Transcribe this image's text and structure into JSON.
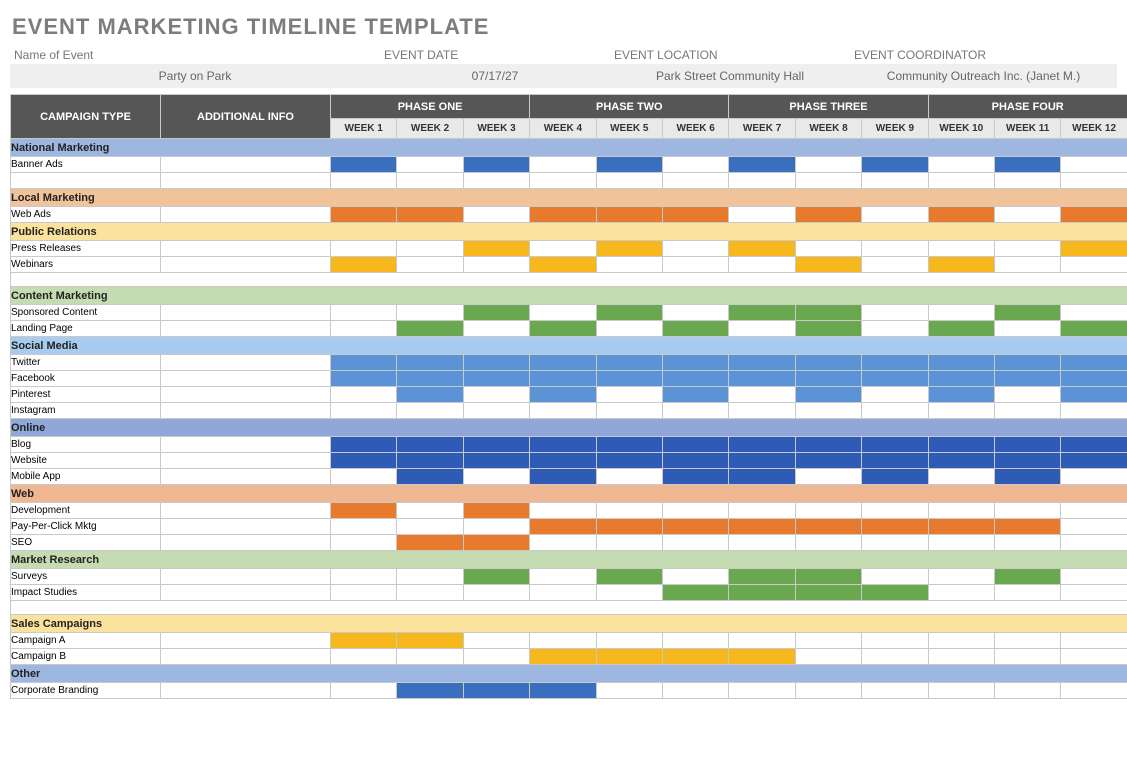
{
  "title": "EVENT MARKETING TIMELINE TEMPLATE",
  "meta": {
    "name_label": "Name of Event",
    "name_value": "Party on Park",
    "date_label": "EVENT DATE",
    "date_value": "07/17/27",
    "loc_label": "EVENT LOCATION",
    "loc_value": "Park Street Community Hall",
    "coord_label": "EVENT COORDINATOR",
    "coord_value": "Community Outreach Inc. (Janet M.)"
  },
  "headers": {
    "campaign": "CAMPAIGN TYPE",
    "info": "ADDITIONAL INFO",
    "phases": [
      "PHASE ONE",
      "PHASE TWO",
      "PHASE THREE",
      "PHASE FOUR"
    ],
    "weeks": [
      "WEEK 1",
      "WEEK 2",
      "WEEK 3",
      "WEEK 4",
      "WEEK 5",
      "WEEK 6",
      "WEEK 7",
      "WEEK 8",
      "WEEK 9",
      "WEEK 10",
      "WEEK 11",
      "WEEK 12"
    ]
  },
  "sections": [
    {
      "label": "National Marketing",
      "class": "sh-national",
      "rows": [
        {
          "label": "Banner Ads",
          "color": "c-blue",
          "weeks": [
            1,
            3,
            5,
            7,
            9,
            11
          ]
        },
        {
          "label": "",
          "color": "",
          "weeks": []
        }
      ]
    },
    {
      "label": "Local Marketing",
      "class": "sh-local",
      "rows": [
        {
          "label": "Web Ads",
          "color": "c-orange",
          "weeks": [
            1,
            2,
            4,
            5,
            6,
            8,
            10,
            12
          ]
        }
      ]
    },
    {
      "label": "Public Relations",
      "class": "sh-public",
      "rows": [
        {
          "label": "Press Releases",
          "color": "c-yellow",
          "weeks": [
            3,
            5,
            7,
            12
          ]
        },
        {
          "label": "Webinars",
          "color": "c-yellow",
          "weeks": [
            1,
            4,
            8,
            10
          ]
        }
      ],
      "spacer_after": true
    },
    {
      "label": "Content Marketing",
      "class": "sh-content",
      "rows": [
        {
          "label": "Sponsored Content",
          "color": "c-green",
          "weeks": [
            3,
            5,
            7,
            8,
            11
          ]
        },
        {
          "label": "Landing Page",
          "color": "c-green",
          "weeks": [
            2,
            4,
            6,
            8,
            10,
            12
          ]
        }
      ]
    },
    {
      "label": "Social Media",
      "class": "sh-social",
      "rows": [
        {
          "label": "Twitter",
          "color": "c-blue2",
          "weeks": [
            1,
            2,
            3,
            4,
            5,
            6,
            7,
            8,
            9,
            10,
            11,
            12
          ]
        },
        {
          "label": "Facebook",
          "color": "c-blue2",
          "weeks": [
            1,
            2,
            3,
            4,
            5,
            6,
            7,
            8,
            9,
            10,
            11,
            12
          ]
        },
        {
          "label": "Pinterest",
          "color": "c-blue2",
          "weeks": [
            2,
            4,
            6,
            8,
            10,
            12
          ]
        },
        {
          "label": "Instagram",
          "color": "c-blue2",
          "weeks": []
        }
      ]
    },
    {
      "label": "Online",
      "class": "sh-online",
      "rows": [
        {
          "label": "Blog",
          "color": "c-blue3",
          "weeks": [
            1,
            2,
            3,
            4,
            5,
            6,
            7,
            8,
            9,
            10,
            11,
            12
          ]
        },
        {
          "label": "Website",
          "color": "c-blue3",
          "weeks": [
            1,
            2,
            3,
            4,
            5,
            6,
            7,
            8,
            9,
            10,
            11,
            12
          ]
        },
        {
          "label": "Mobile App",
          "color": "c-blue3",
          "weeks": [
            2,
            4,
            6,
            7,
            9,
            11
          ]
        }
      ]
    },
    {
      "label": "Web",
      "class": "sh-web",
      "rows": [
        {
          "label": "Development",
          "color": "c-orange",
          "weeks": [
            1,
            3
          ]
        },
        {
          "label": "Pay-Per-Click Mktg",
          "color": "c-orange",
          "weeks": [
            4,
            5,
            6,
            7,
            8,
            9,
            10,
            11
          ]
        },
        {
          "label": "SEO",
          "color": "c-orange",
          "weeks": [
            2,
            3
          ]
        }
      ]
    },
    {
      "label": "Market Research",
      "class": "sh-market",
      "rows": [
        {
          "label": "Surveys",
          "color": "c-green",
          "weeks": [
            3,
            5,
            7,
            8,
            11
          ]
        },
        {
          "label": "Impact Studies",
          "color": "c-green",
          "weeks": [
            6,
            7,
            8,
            9
          ]
        }
      ],
      "spacer_after": true
    },
    {
      "label": "Sales Campaigns",
      "class": "sh-sales",
      "rows": [
        {
          "label": "Campaign A",
          "color": "c-yellow",
          "weeks": [
            1,
            2
          ]
        },
        {
          "label": "Campaign B",
          "color": "c-yellow",
          "weeks": [
            4,
            5,
            6,
            7
          ]
        }
      ]
    },
    {
      "label": "Other",
      "class": "sh-other",
      "rows": [
        {
          "label": "Corporate Branding",
          "color": "c-blue",
          "weeks": [
            2,
            3,
            4
          ]
        }
      ]
    }
  ]
}
